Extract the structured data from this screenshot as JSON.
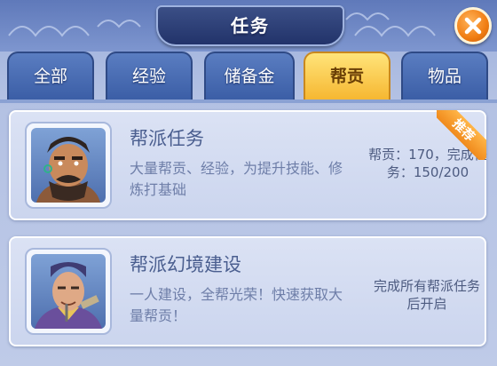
{
  "window": {
    "title": "任务",
    "close_icon": "close-icon"
  },
  "tabs": [
    {
      "label": "全部",
      "active": false
    },
    {
      "label": "经验",
      "active": false
    },
    {
      "label": "储备金",
      "active": false
    },
    {
      "label": "帮贡",
      "active": true
    },
    {
      "label": "物品",
      "active": false
    }
  ],
  "quests": [
    {
      "title": "帮派任务",
      "description": "大量帮贡、经验，为提升技能、修炼打基础",
      "status": "帮贡：170，完成任务：150/200",
      "badge": "推荐",
      "portrait": "bearded-warrior-portrait"
    },
    {
      "title": "帮派幻境建设",
      "description": "一人建设，全帮光荣！快速获取大量帮贡！",
      "status": "完成所有帮派任务后开启",
      "portrait": "old-scholar-portrait"
    }
  ],
  "colors": {
    "active_tab": "#f6b731",
    "inactive_tab": "#3b5ea6",
    "close_button": "#f07d12",
    "badge": "#f08a1c"
  }
}
